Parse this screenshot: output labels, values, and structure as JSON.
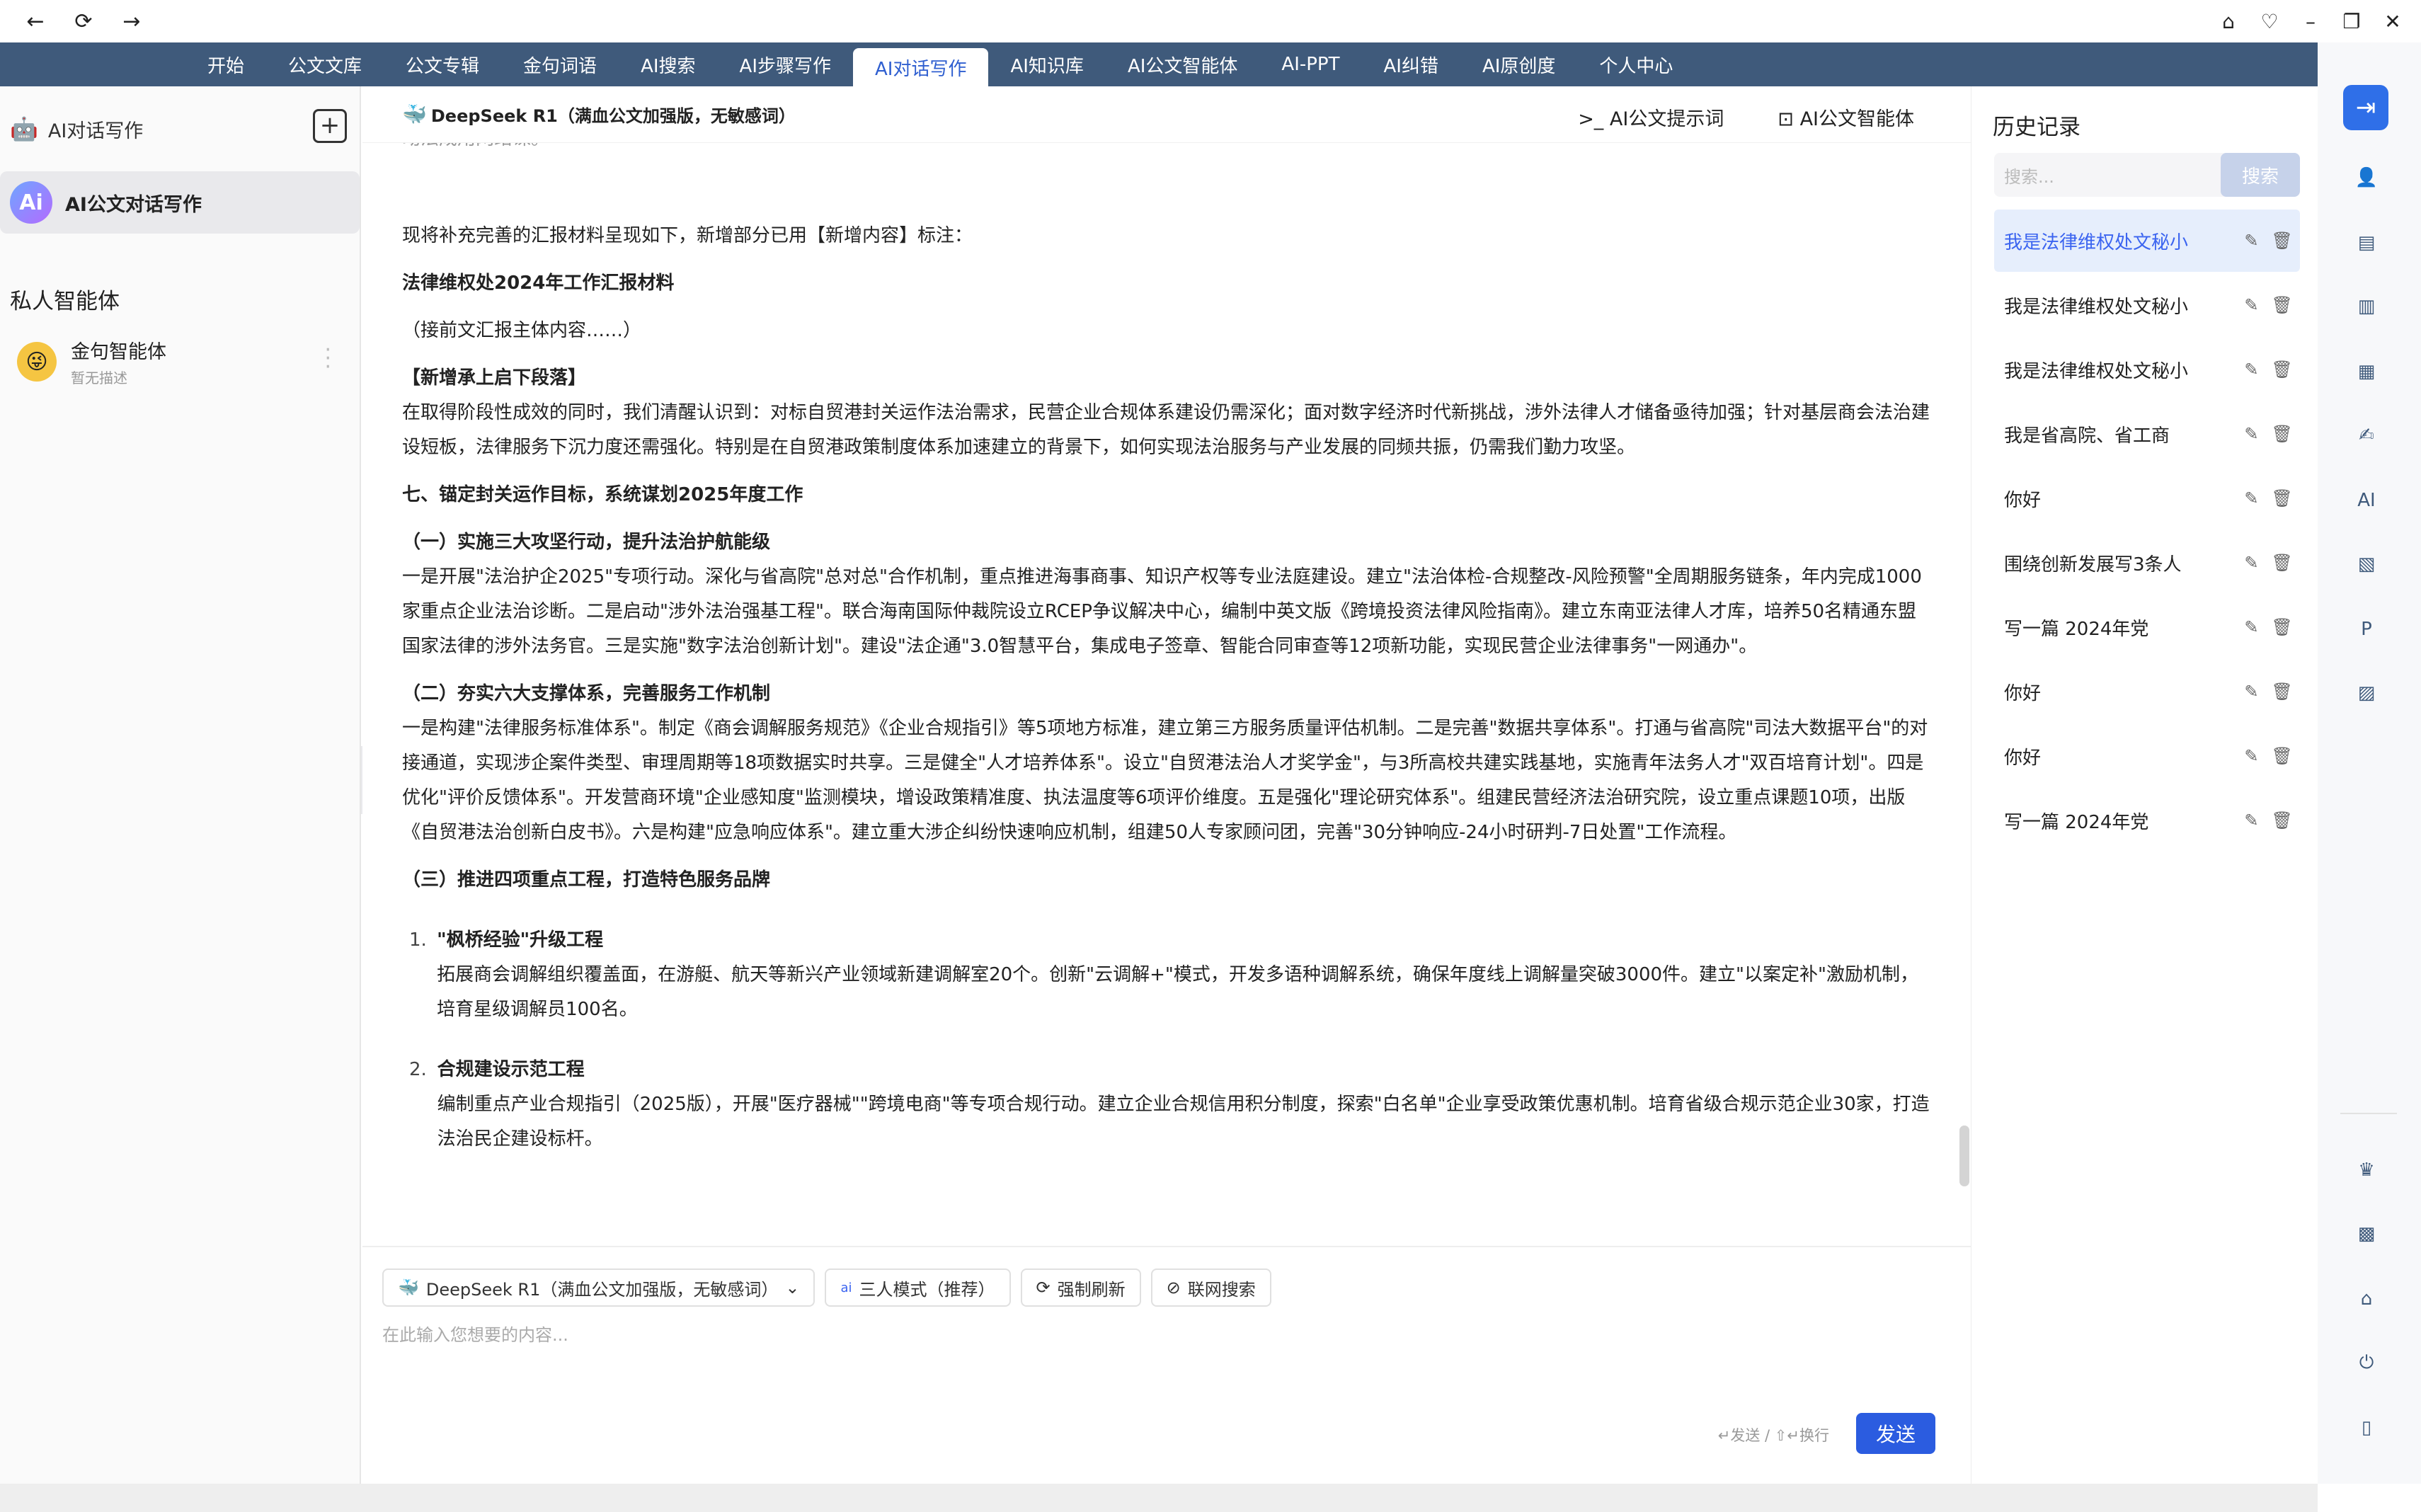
{
  "titlebar": {
    "back": "←",
    "reload": "⟳",
    "forward": "→",
    "home": "⌂",
    "shield": "♡",
    "minimize": "–",
    "restore": "❐",
    "close": "✕"
  },
  "nav": {
    "tabs": [
      "开始",
      "公文文库",
      "公文专辑",
      "金句词语",
      "AI搜索",
      "AI步骤写作",
      "AI对话写作",
      "AI知识库",
      "AI公文智能体",
      "AI-PPT",
      "AI纠错",
      "AI原创度",
      "个人中心"
    ],
    "active": "AI对话写作"
  },
  "left": {
    "title": "AI对话写作",
    "active_item": "AI公文对话写作",
    "avatar_text": "Ai",
    "section": "私人智能体",
    "agent": {
      "name": "金句智能体",
      "desc": "暂无描述"
    }
  },
  "main": {
    "model": "DeepSeek R1（满血公文加强版，无敏感词）",
    "links": [
      "AI公文提示词",
      "AI公文智能体"
    ],
    "content": {
      "partial": "动法成用网络课。",
      "intro": "现将补充完善的汇报材料呈现如下，新增部分已用【新增内容】标注：",
      "doc_title": "法律维权处2024年工作汇报材料",
      "cont": "（接前文汇报主体内容……）",
      "new_tag": "【新增承上启下段落】",
      "p1": "在取得阶段性成效的同时，我们清醒认识到：对标自贸港封关运作法治需求，民营企业合规体系建设仍需深化；面对数字经济时代新挑战，涉外法律人才储备亟待加强；针对基层商会法治建设短板，法律服务下沉力度还需强化。特别是在自贸港政策制度体系加速建立的背景下，如何实现法治服务与产业发展的同频共振，仍需我们勤力攻坚。",
      "h7": "七、锚定封关运作目标，系统谋划2025年度工作",
      "h1": "（一）实施三大攻坚行动，提升法治护航能级",
      "p2": "一是开展\"法治护企2025\"专项行动。深化与省高院\"总对总\"合作机制，重点推进海事商事、知识产权等专业法庭建设。建立\"法治体检-合规整改-风险预警\"全周期服务链条，年内完成1000家重点企业法治诊断。二是启动\"涉外法治强基工程\"。联合海南国际仲裁院设立RCEP争议解决中心，编制中英文版《跨境投资法律风险指南》。建立东南亚法律人才库，培养50名精通东盟国家法律的涉外法务官。三是实施\"数字法治创新计划\"。建设\"法企通\"3.0智慧平台，集成电子签章、智能合同审查等12项新功能，实现民营企业法律事务\"一网通办\"。",
      "h2": "（二）夯实六大支撑体系，完善服务工作机制",
      "p3": "一是构建\"法律服务标准体系\"。制定《商会调解服务规范》《企业合规指引》等5项地方标准，建立第三方服务质量评估机制。二是完善\"数据共享体系\"。打通与省高院\"司法大数据平台\"的对接通道，实现涉企案件类型、审理周期等18项数据实时共享。三是健全\"人才培养体系\"。设立\"自贸港法治人才奖学金\"，与3所高校共建实践基地，实施青年法务人才\"双百培育计划\"。四是优化\"评价反馈体系\"。开发营商环境\"企业感知度\"监测模块，增设政策精准度、执法温度等6项评价维度。五是强化\"理论研究体系\"。组建民营经济法治研究院，设立重点课题10项，出版《自贸港法治创新白皮书》。六是构建\"应急响应体系\"。建立重大涉企纠纷快速响应机制，组建50人专家顾问团，完善\"30分钟响应-24小时研判-7日处置\"工作流程。",
      "h3": "（三）推进四项重点工程，打造特色服务品牌",
      "items": [
        {
          "num": "1.",
          "title": "\"枫桥经验\"升级工程",
          "text": "拓展商会调解组织覆盖面，在游艇、航天等新兴产业领域新建调解室20个。创新\"云调解+\"模式，开发多语种调解系统，确保年度线上调解量突破3000件。建立\"以案定补\"激励机制，培育星级调解员100名。"
        },
        {
          "num": "2.",
          "title": "合规建设示范工程",
          "text": "编制重点产业合规指引（2025版），开展\"医疗器械\"\"跨境电商\"等专项合规行动。建立企业合规信用积分制度，探索\"白名单\"企业享受政策优惠机制。培育省级合规示范企业30家，打造法治民企建设标杆。"
        }
      ]
    }
  },
  "input": {
    "model_chip": "DeepSeek R1（满血公文加强版，无敏感词）",
    "mode_chip": "三人模式（推荐）",
    "refresh_chip": "强制刷新",
    "web_chip": "联网搜索",
    "placeholder": "在此输入您想要的内容...",
    "hint": "↵发送 / ⇧↵换行",
    "send": "发送"
  },
  "history": {
    "title": "历史记录",
    "search_placeholder": "搜索...",
    "search_btn": "搜索",
    "items": [
      "我是法律维权处文秘小",
      "我是法律维权处文秘小",
      "我是法律维权处文秘小",
      "我是省高院、省工商",
      "你好",
      "围绕创新发展写3条人",
      "写一篇 2024年党",
      "你好",
      "你好",
      "写一篇 2024年党"
    ]
  }
}
